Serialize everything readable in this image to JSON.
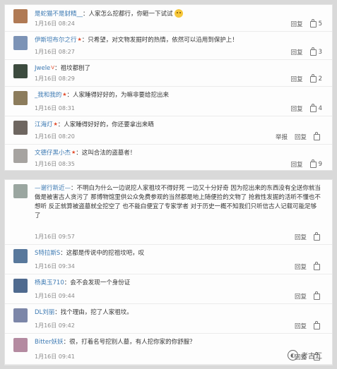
{
  "colors": {
    "username": "#3d7ab3",
    "badge": "#e24b2a",
    "date": "#8a8a8a"
  },
  "panel_top": {
    "comments": [
      {
        "user": "是蛇猫不是豺精__",
        "badge": "",
        "text": "：人家怎么挖都行，你砸一下试试",
        "emoji": true,
        "date": "1月16日 08:24",
        "extra_action": "",
        "reply": "回复",
        "likes": "5",
        "avatar_color": "#b07a54"
      },
      {
        "user": "伊斯坦布尔之行",
        "badge": "★",
        "text": "：只希望，对文物发掘时的热情，依然可以沿用到保护上！",
        "emoji": false,
        "date": "1月16日 08:27",
        "extra_action": "",
        "reply": "回复",
        "likes": "3",
        "avatar_color": "#7c93b6"
      },
      {
        "user": "Jwele",
        "badge": "V",
        "text": "：祖坟都刨了",
        "emoji": false,
        "date": "1月16日 08:29",
        "extra_action": "",
        "reply": "回复",
        "likes": "2",
        "avatar_color": "#3c4b3e"
      },
      {
        "user": "_我和我的",
        "badge": "★",
        "text": "：人家睡得好好的，为嘛非要给挖出来",
        "emoji": false,
        "date": "1月16日 08:31",
        "extra_action": "",
        "reply": "回复",
        "likes": "4",
        "avatar_color": "#8c7c5c"
      },
      {
        "user": "江海灯",
        "badge": "★",
        "text": "：人家睡得好好的，你还要拿出来晒",
        "emoji": false,
        "date": "1月16日 08:20",
        "extra_action": "举报",
        "reply": "回复",
        "likes": "",
        "avatar_color": "#6e6660"
      },
      {
        "user": "文德仔黑小杰",
        "badge": "★",
        "text": "：这叫合法的盗墓者！",
        "emoji": false,
        "date": "1月16日 08:35",
        "extra_action": "",
        "reply": "回复",
        "likes": "9",
        "avatar_color": "#a6a3a0"
      }
    ]
  },
  "panel_bottom": {
    "comments": [
      {
        "user": "—谢行新近—",
        "badge": "",
        "text": "：不明白为什么一边说挖人家祖坟不得好死 一边又十分好奇 因为挖出来的东西没有全送你就当做是被害古人贪污了 那博物馆里供公众免费参观的当然都是地上随便捡的文物了 抢救性发掘的活听不懂也不想听 反正就算被盗墓就全挖空了 也不能白便宜了专家学者 对于历史一概不知我们只听信古人记载可能足够了",
        "emoji": false,
        "date": "1月16日 09:57",
        "extra_action": "",
        "reply": "回复",
        "likes": "",
        "avatar_color": "#9aa6a0"
      },
      {
        "user": "S特拉斯S",
        "badge": "",
        "text": "：这都是传说中的挖祖坟吧，叹",
        "emoji": false,
        "date": "1月16日 09:34",
        "extra_action": "",
        "reply": "回复",
        "likes": "",
        "avatar_color": "#58789c"
      },
      {
        "user": "杨奥玉710",
        "badge": "",
        "text": "：会不会发现一个身份证",
        "emoji": false,
        "date": "1月16日 09:44",
        "extra_action": "",
        "reply": "回复",
        "likes": "",
        "avatar_color": "#4f6a8f"
      },
      {
        "user": "DL刘丽",
        "badge": "",
        "text": "：找个理由，挖了人家祖坟。",
        "emoji": false,
        "date": "1月16日 09:42",
        "extra_action": "",
        "reply": "回复",
        "likes": "",
        "avatar_color": "#7c86a8"
      },
      {
        "user": "Bitter妖妖",
        "badge": "",
        "text": "：很，打着名号挖别人墓，有人挖你家的你舒服？",
        "emoji": false,
        "date": "1月16日 09:41",
        "extra_action": "",
        "reply": "回复",
        "likes": "",
        "avatar_color": "#b48aa0"
      }
    ],
    "watermark": "考古汇"
  }
}
